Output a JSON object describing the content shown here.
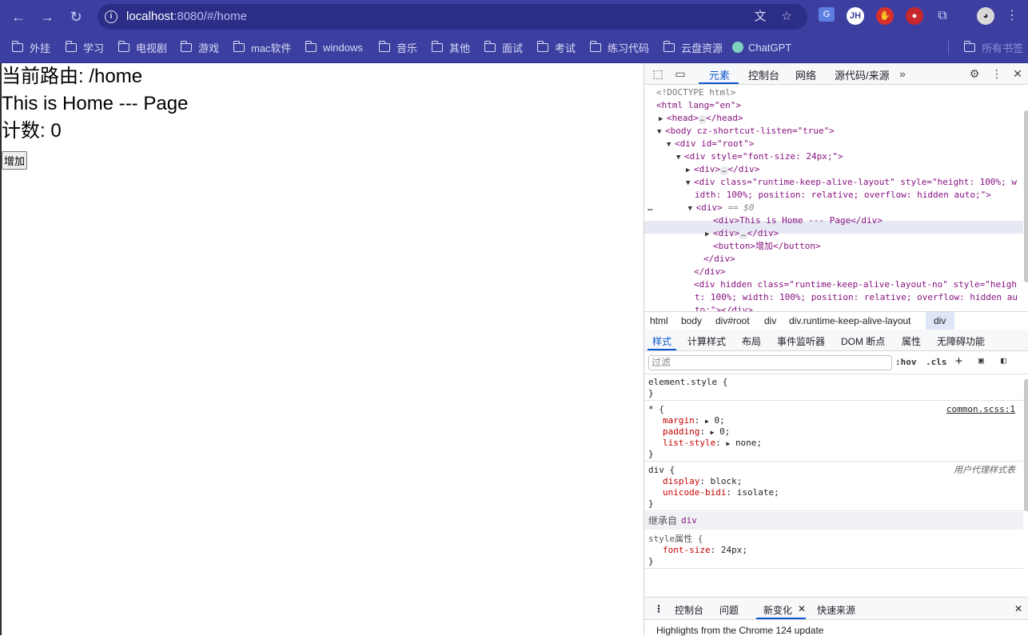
{
  "browser": {
    "url_host": "localhost",
    "url_rest": ":8080/#/home",
    "profile_initials": "JH"
  },
  "bookmarks": [
    {
      "label": "外挂"
    },
    {
      "label": "学习"
    },
    {
      "label": "电视剧"
    },
    {
      "label": "游戏"
    },
    {
      "label": "mac软件"
    },
    {
      "label": "windows"
    },
    {
      "label": "音乐"
    },
    {
      "label": "其他"
    },
    {
      "label": "面试"
    },
    {
      "label": "考试"
    },
    {
      "label": "练习代码"
    },
    {
      "label": "云盘资源"
    },
    {
      "label": "ChatGPT"
    },
    {
      "label": "所有书签"
    }
  ],
  "page": {
    "route_line": "当前路由: /home",
    "home_text": "This is Home --- Page",
    "count_line": "计数: 0",
    "add_button": "增加"
  },
  "devtools": {
    "tabs": [
      "元素",
      "控制台",
      "网络",
      "源代码/来源"
    ],
    "dom": {
      "doctype": "<!DOCTYPE html>",
      "html_open": "<html lang=\"en\">",
      "head": "<head>",
      "head_close": "</head>",
      "body": "<body cz-shortcut-listen=\"true\">",
      "root": "<div id=\"root\">",
      "style_div": "<div style=\"font-size: 24px;\">",
      "collapsed_div": "<div>",
      "collapsed_div_close": "</div>",
      "layout_div_1": "<div class=\"runtime-keep-alive-layout\" style=\"height: 100%; w",
      "layout_div_2": "idth: 100%; position: relative; overflow: hidden auto;\">",
      "selected_div": "<div>",
      "selected_marker": "== $0",
      "text_div": "<div>This is Home --- Page</div>",
      "inner_div": "<div>",
      "inner_div_close": "</div>",
      "button": "<button>增加</button>",
      "close_div_1": "</div>",
      "close_div_2": "</div>",
      "hidden_div_1": "<div hidden class=\"runtime-keep-alive-layout-no\" style=\"heigh",
      "hidden_div_2": "t: 100%; width: 100%; position: relative; overflow: hidden au",
      "hidden_div_3": "to;\"></div>"
    },
    "breadcrumbs": [
      "html",
      "body",
      "div#root",
      "div",
      "div.runtime-keep-alive-layout",
      "div"
    ],
    "sub_tabs": [
      "样式",
      "计算样式",
      "布局",
      "事件监听器",
      "DOM 断点",
      "属性",
      "无障碍功能"
    ],
    "filter_placeholder": "过滤",
    "filter_hov": ":hov",
    "filter_cls": ".cls",
    "styles": {
      "element_style": "element.style {",
      "close": "}",
      "star_selector": "* {",
      "star_source": "common.scss:1",
      "margin_prop": "margin",
      "margin_val": "0;",
      "padding_prop": "padding",
      "padding_val": "0;",
      "list_prop": "list-style",
      "list_val": "none;",
      "div_selector": "div {",
      "ua_source": "用户代理样式表",
      "display_prop": "display",
      "display_val": "block;",
      "bidi_prop": "unicode-bidi",
      "bidi_val": "isolate;",
      "inherit_label": "继承自",
      "inherit_target": "div",
      "style_attr": "style属性 {",
      "font_prop": "font-size",
      "font_val": "24px;"
    },
    "drawer_tabs": [
      "控制台",
      "问题",
      "新变化",
      "快速来源"
    ],
    "drawer_highlight": "Highlights from the Chrome 124 update"
  }
}
